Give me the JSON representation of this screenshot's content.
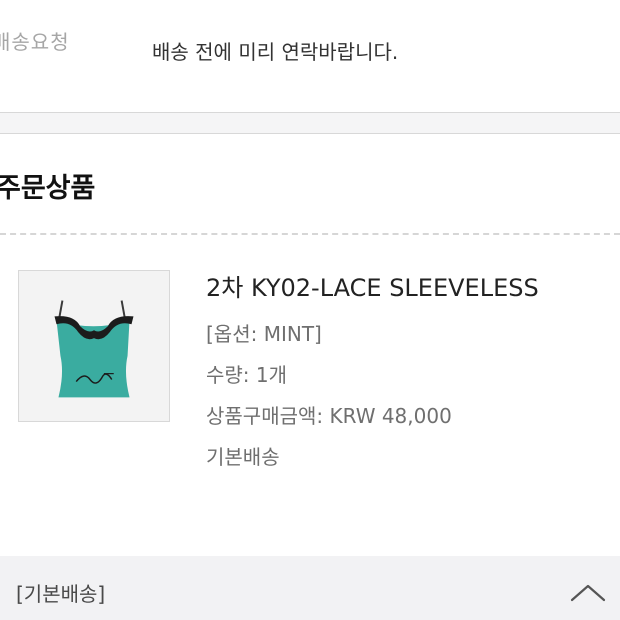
{
  "delivery_request": {
    "label": "배송요청",
    "value": "배송 전에 미리 연락바랍니다."
  },
  "order_section": {
    "title": "주문상품"
  },
  "product": {
    "image_icon": "sleeveless-top-product-image",
    "name": "2차 KY02-LACE SLEEVELESS",
    "option": "[옵션: MINT]",
    "quantity": "수량: 1개",
    "price": "상품구매금액: KRW 48,000",
    "shipping_type": "기본배송",
    "colors": {
      "garment": "#3aaca0",
      "lace": "#1c1c1c"
    }
  },
  "shipping_bar": {
    "label": "[기본배송]",
    "toggle_icon": "chevron-up-icon"
  }
}
